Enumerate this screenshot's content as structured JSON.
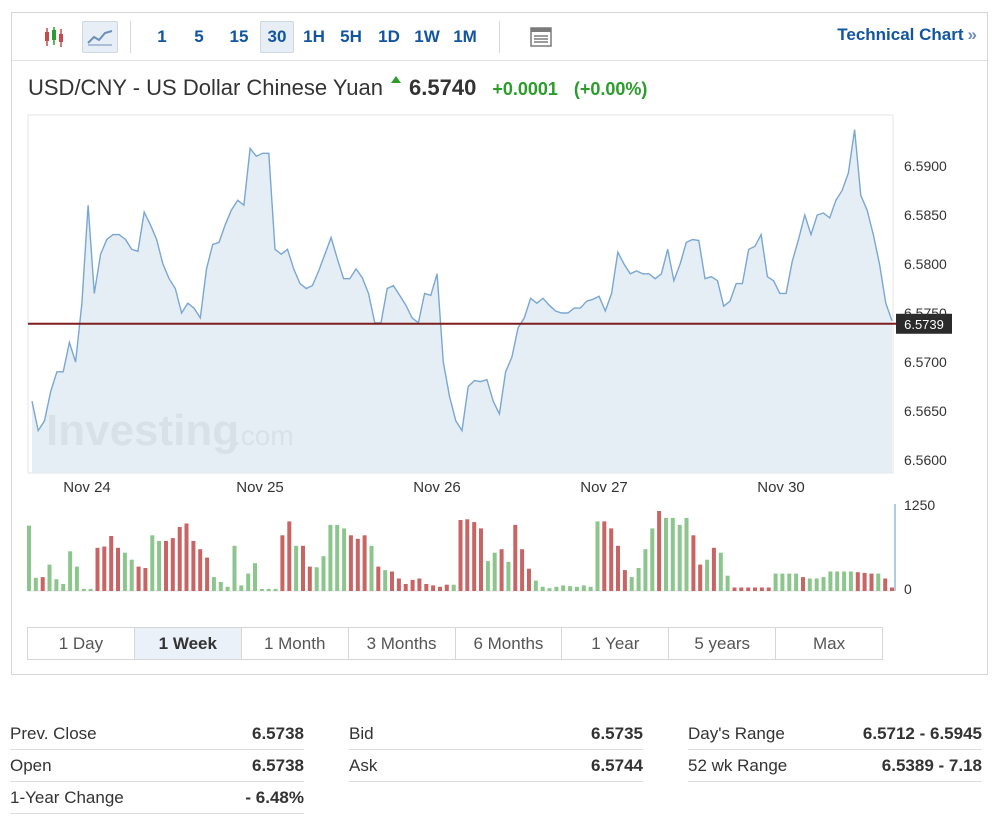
{
  "toolbar": {
    "intervals": [
      "1",
      "5",
      "15",
      "30",
      "1H",
      "5H",
      "1D",
      "1W",
      "1M"
    ],
    "active_interval": "30",
    "technical_chart_label": "Technical Chart",
    "technical_chart_arrows": "»",
    "icons": [
      "candlestick-icon",
      "line-chart-icon",
      "layout-icon"
    ]
  },
  "header": {
    "title": "USD/CNY - US Dollar Chinese Yuan",
    "price": "6.5740",
    "change": "+0.0001",
    "change_pct": "(+0.00%)"
  },
  "chart_data": {
    "type": "area",
    "x_labels": [
      "Nov 24",
      "Nov 25",
      "Nov 26",
      "Nov 27",
      "Nov 30"
    ],
    "y_ticks": [
      "6.5900",
      "6.5850",
      "6.5800",
      "6.5750",
      "6.5700",
      "6.5650",
      "6.5600"
    ],
    "ylim": [
      6.559,
      6.5945
    ],
    "current_price_label": "6.5739",
    "current_price": 6.5739,
    "watermark": "Investing.com",
    "values": [
      6.566,
      6.563,
      6.564,
      6.567,
      6.569,
      6.569,
      6.572,
      6.57,
      6.576,
      6.586,
      6.577,
      6.581,
      6.5825,
      6.583,
      6.583,
      6.5825,
      6.5815,
      6.5813,
      6.5853,
      6.584,
      6.5825,
      6.58,
      6.5785,
      6.5775,
      6.575,
      6.576,
      6.5755,
      6.5745,
      6.5795,
      6.582,
      6.5822,
      6.584,
      6.5855,
      6.5865,
      6.586,
      6.5918,
      6.591,
      6.5913,
      6.5913,
      6.5815,
      6.581,
      6.5815,
      6.5795,
      6.578,
      6.5775,
      6.5778,
      6.5793,
      6.581,
      6.5827,
      6.5805,
      6.5785,
      6.5785,
      6.5795,
      6.5786,
      6.577,
      6.574,
      6.574,
      6.5775,
      6.5778,
      6.5768,
      6.5758,
      6.5745,
      6.574,
      6.577,
      6.5768,
      6.579,
      6.57,
      6.5665,
      6.564,
      6.563,
      6.5675,
      6.5681,
      6.568,
      6.5682,
      6.566,
      6.5647,
      6.569,
      6.5705,
      6.5735,
      6.5745,
      6.5765,
      6.576,
      6.5765,
      6.5758,
      6.5752,
      6.575,
      6.575,
      6.5755,
      6.5755,
      6.5762,
      6.5764,
      6.5767,
      6.5752,
      6.577,
      6.5812,
      6.58,
      6.579,
      6.5793,
      6.579,
      6.579,
      6.5785,
      6.579,
      6.5815,
      6.5783,
      6.58,
      6.5822,
      6.5825,
      6.5824,
      6.5785,
      6.5787,
      6.5783,
      6.5757,
      6.5762,
      6.578,
      6.578,
      6.5815,
      6.5818,
      6.583,
      6.5787,
      6.5783,
      6.577,
      6.577,
      6.5803,
      6.5825,
      6.585,
      6.583,
      6.585,
      6.5852,
      6.5847,
      6.5865,
      6.5875,
      6.5893,
      6.5937,
      6.587,
      6.5855,
      6.583,
      6.58,
      6.576,
      6.5742
    ],
    "volume_ylim": [
      0,
      1250
    ],
    "volume_ticks": [
      "1250",
      "0"
    ],
    "volumes": [
      [
        940,
        "up"
      ],
      [
        190,
        "up"
      ],
      [
        200,
        "down"
      ],
      [
        380,
        "up"
      ],
      [
        170,
        "up"
      ],
      [
        100,
        "up"
      ],
      [
        570,
        "up"
      ],
      [
        350,
        "up"
      ],
      [
        30,
        "up"
      ],
      [
        30,
        "up"
      ],
      [
        620,
        "down"
      ],
      [
        640,
        "down"
      ],
      [
        790,
        "down"
      ],
      [
        620,
        "down"
      ],
      [
        550,
        "up"
      ],
      [
        450,
        "up"
      ],
      [
        350,
        "down"
      ],
      [
        330,
        "down"
      ],
      [
        800,
        "up"
      ],
      [
        720,
        "up"
      ],
      [
        720,
        "down"
      ],
      [
        760,
        "down"
      ],
      [
        920,
        "down"
      ],
      [
        970,
        "down"
      ],
      [
        720,
        "down"
      ],
      [
        600,
        "down"
      ],
      [
        480,
        "down"
      ],
      [
        200,
        "up"
      ],
      [
        130,
        "up"
      ],
      [
        60,
        "up"
      ],
      [
        650,
        "up"
      ],
      [
        80,
        "up"
      ],
      [
        250,
        "up"
      ],
      [
        400,
        "up"
      ],
      [
        30,
        "up"
      ],
      [
        30,
        "up"
      ],
      [
        30,
        "up"
      ],
      [
        800,
        "down"
      ],
      [
        1000,
        "down"
      ],
      [
        650,
        "up"
      ],
      [
        650,
        "down"
      ],
      [
        350,
        "down"
      ],
      [
        340,
        "up"
      ],
      [
        500,
        "up"
      ],
      [
        950,
        "up"
      ],
      [
        950,
        "up"
      ],
      [
        900,
        "up"
      ],
      [
        800,
        "down"
      ],
      [
        750,
        "down"
      ],
      [
        800,
        "down"
      ],
      [
        650,
        "up"
      ],
      [
        350,
        "down"
      ],
      [
        300,
        "up"
      ],
      [
        280,
        "down"
      ],
      [
        180,
        "down"
      ],
      [
        100,
        "down"
      ],
      [
        160,
        "down"
      ],
      [
        180,
        "down"
      ],
      [
        100,
        "down"
      ],
      [
        80,
        "down"
      ],
      [
        60,
        "down"
      ],
      [
        90,
        "down"
      ],
      [
        90,
        "up"
      ],
      [
        1020,
        "down"
      ],
      [
        1030,
        "down"
      ],
      [
        990,
        "down"
      ],
      [
        900,
        "down"
      ],
      [
        430,
        "up"
      ],
      [
        550,
        "up"
      ],
      [
        600,
        "down"
      ],
      [
        420,
        "up"
      ],
      [
        950,
        "down"
      ],
      [
        600,
        "down"
      ],
      [
        320,
        "down"
      ],
      [
        150,
        "up"
      ],
      [
        60,
        "up"
      ],
      [
        40,
        "up"
      ],
      [
        60,
        "up"
      ],
      [
        80,
        "up"
      ],
      [
        70,
        "up"
      ],
      [
        60,
        "up"
      ],
      [
        80,
        "up"
      ],
      [
        60,
        "up"
      ],
      [
        1000,
        "up"
      ],
      [
        1000,
        "down"
      ],
      [
        900,
        "down"
      ],
      [
        650,
        "down"
      ],
      [
        300,
        "down"
      ],
      [
        200,
        "up"
      ],
      [
        330,
        "up"
      ],
      [
        600,
        "up"
      ],
      [
        900,
        "up"
      ],
      [
        1150,
        "down"
      ],
      [
        1050,
        "up"
      ],
      [
        1050,
        "up"
      ],
      [
        950,
        "up"
      ],
      [
        1050,
        "up"
      ],
      [
        800,
        "down"
      ],
      [
        380,
        "down"
      ],
      [
        450,
        "up"
      ],
      [
        620,
        "down"
      ],
      [
        550,
        "up"
      ],
      [
        220,
        "up"
      ],
      [
        50,
        "down"
      ],
      [
        50,
        "down"
      ],
      [
        50,
        "down"
      ],
      [
        50,
        "down"
      ],
      [
        50,
        "down"
      ],
      [
        50,
        "down"
      ],
      [
        250,
        "up"
      ],
      [
        250,
        "up"
      ],
      [
        250,
        "up"
      ],
      [
        250,
        "up"
      ],
      [
        200,
        "down"
      ],
      [
        180,
        "up"
      ],
      [
        180,
        "up"
      ],
      [
        200,
        "up"
      ],
      [
        280,
        "up"
      ],
      [
        280,
        "up"
      ],
      [
        280,
        "up"
      ],
      [
        280,
        "up"
      ],
      [
        270,
        "down"
      ],
      [
        260,
        "down"
      ],
      [
        250,
        "down"
      ],
      [
        250,
        "up"
      ],
      [
        180,
        "down"
      ],
      [
        50,
        "down"
      ]
    ]
  },
  "periods": {
    "items": [
      "1 Day",
      "1 Week",
      "1 Month",
      "3 Months",
      "6 Months",
      "1 Year",
      "5 years",
      "Max"
    ],
    "active": "1 Week"
  },
  "stats": {
    "col1": [
      {
        "label": "Prev. Close",
        "value": "6.5738"
      },
      {
        "label": "Open",
        "value": "6.5738"
      },
      {
        "label": "1-Year Change",
        "value": "- 6.48%"
      }
    ],
    "col2": [
      {
        "label": "Bid",
        "value": "6.5735"
      },
      {
        "label": "Ask",
        "value": "6.5744"
      }
    ],
    "col3": [
      {
        "label": "Day's Range",
        "value": "6.5712 - 6.5945"
      },
      {
        "label": "52 wk Range",
        "value": "6.5389 - 7.18"
      }
    ]
  },
  "colors": {
    "accent": "#1256a0",
    "up": "#2a9d2a",
    "line": "#7aa7d2",
    "area": "#e1ebf3",
    "price_line": "#7d1f1f",
    "vol_up": "#8cc68d",
    "vol_down": "#c96464"
  }
}
